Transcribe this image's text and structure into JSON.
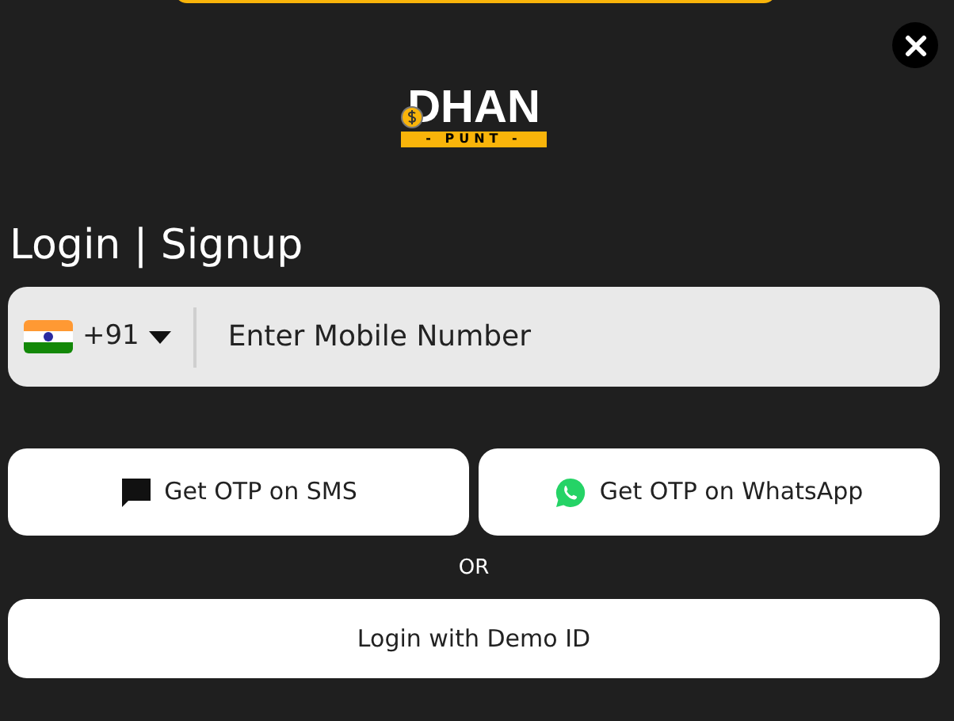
{
  "logo": {
    "name": "DHAN",
    "tagline": "- PUNT -"
  },
  "title": "Login | Signup",
  "phone": {
    "country_code": "+91",
    "placeholder": "Enter Mobile Number"
  },
  "otp_buttons": [
    {
      "kind": "sms",
      "label": "Get OTP on SMS"
    },
    {
      "kind": "whatsapp",
      "label": "Get OTP on WhatsApp"
    }
  ],
  "separator": "OR",
  "demo_button": "Login with Demo ID"
}
